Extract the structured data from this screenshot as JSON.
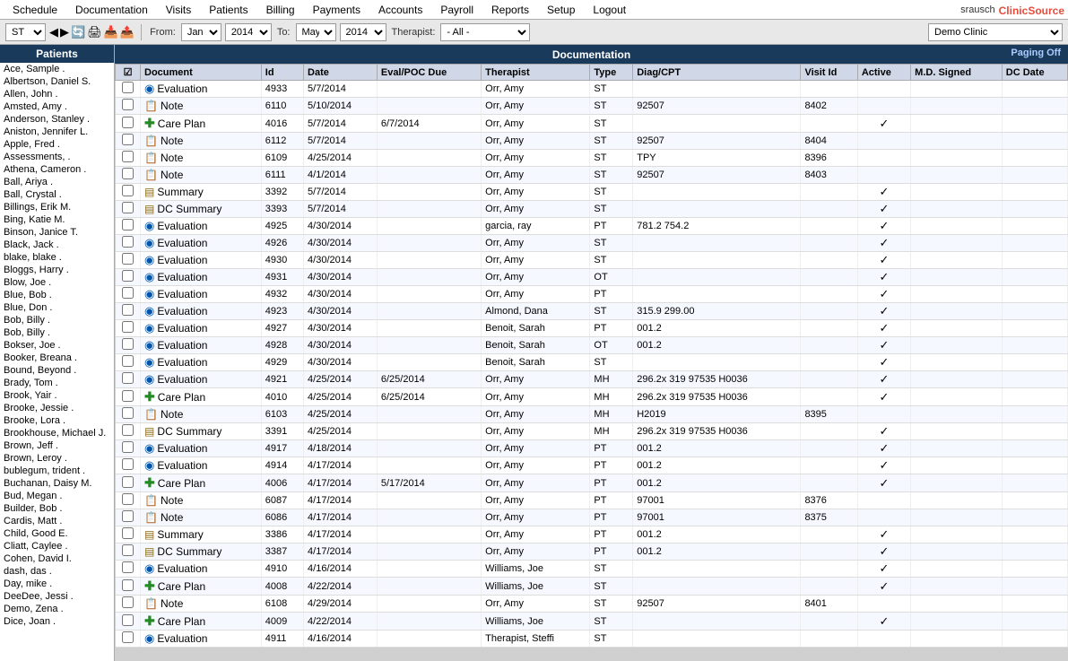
{
  "nav": {
    "items": [
      "Schedule",
      "Documentation",
      "Visits",
      "Patients",
      "Billing",
      "Payments",
      "Accounts",
      "Payroll",
      "Reports",
      "Setup",
      "Logout"
    ],
    "user": "srausch",
    "brand_prefix": "Clinic",
    "brand_suffix": "Source"
  },
  "toolbar": {
    "type_label": "ST",
    "from_label": "From:",
    "from_month": "Jan",
    "from_year": "2014",
    "to_label": "To:",
    "to_month": "May",
    "to_year": "2014",
    "therapist_label": "Therapist:",
    "therapist_value": "- All -",
    "clinic_name": "Demo Clinic"
  },
  "patients": {
    "header": "Patients",
    "list": [
      "Ace, Sample .",
      "Albertson, Daniel S.",
      "Allen, John .",
      "Amsted, Amy .",
      "Anderson, Stanley .",
      "Aniston, Jennifer L.",
      "Apple, Fred .",
      "Assessments, .",
      "Athena, Cameron .",
      "Ball, Ariya .",
      "Ball, Crystal .",
      "Billings, Erik M.",
      "Bing, Katie M.",
      "Binson, Janice T.",
      "Black, Jack .",
      "blake, blake .",
      "Bloggs, Harry .",
      "Blow, Joe .",
      "Blue, Bob .",
      "Blue, Don .",
      "Bob, Billy .",
      "Bob, Billy .",
      "Bokser, Joe .",
      "Booker, Breana .",
      "Bound, Beyond .",
      "Brady, Tom .",
      "Brook, Yair .",
      "Brooke, Jessie .",
      "Brooke, Lora .",
      "Brookhouse, Michael J.",
      "Brown, Jeff .",
      "Brown, Leroy .",
      "bublegum, trident .",
      "Buchanan, Daisy M.",
      "Bud, Megan .",
      "Builder, Bob .",
      "Cardis, Matt .",
      "Child, Good E.",
      "Cliatt, Caylee .",
      "Cohen, David I.",
      "dash, das .",
      "Day, mike .",
      "DeeDee, Jessi .",
      "Demo, Zena .",
      "Dice, Joan ."
    ]
  },
  "documentation": {
    "header": "Documentation",
    "paging_off": "Paging Off",
    "columns": [
      "",
      "Document",
      "Id",
      "Date",
      "Eval/POC Due",
      "Therapist",
      "Type",
      "Diag/CPT",
      "Visit Id",
      "Active",
      "M.D. Signed",
      "DC Date"
    ],
    "rows": [
      {
        "checked": false,
        "icon": "eval",
        "doc": "Evaluation",
        "id": "4933",
        "date": "5/7/2014",
        "eval_due": "",
        "therapist": "Orr, Amy",
        "type": "ST",
        "diag": "",
        "visit_id": "",
        "active": false,
        "md_signed": false,
        "dc_date": ""
      },
      {
        "checked": false,
        "icon": "note",
        "doc": "Note",
        "id": "6110",
        "date": "5/10/2014",
        "eval_due": "",
        "therapist": "Orr, Amy",
        "type": "ST",
        "diag": "92507",
        "visit_id": "8402",
        "active": false,
        "md_signed": false,
        "dc_date": ""
      },
      {
        "checked": false,
        "icon": "careplan",
        "doc": "Care Plan",
        "id": "4016",
        "date": "5/7/2014",
        "eval_due": "6/7/2014",
        "therapist": "Orr, Amy",
        "type": "ST",
        "diag": "",
        "visit_id": "",
        "active": true,
        "md_signed": false,
        "dc_date": ""
      },
      {
        "checked": false,
        "icon": "note",
        "doc": "Note",
        "id": "6112",
        "date": "5/7/2014",
        "eval_due": "",
        "therapist": "Orr, Amy",
        "type": "ST",
        "diag": "92507",
        "visit_id": "8404",
        "active": false,
        "md_signed": false,
        "dc_date": ""
      },
      {
        "checked": false,
        "icon": "note",
        "doc": "Note",
        "id": "6109",
        "date": "4/25/2014",
        "eval_due": "",
        "therapist": "Orr, Amy",
        "type": "ST",
        "diag": "TPY",
        "visit_id": "8396",
        "active": false,
        "md_signed": false,
        "dc_date": ""
      },
      {
        "checked": false,
        "icon": "note",
        "doc": "Note",
        "id": "6111",
        "date": "4/1/2014",
        "eval_due": "",
        "therapist": "Orr, Amy",
        "type": "ST",
        "diag": "92507",
        "visit_id": "8403",
        "active": false,
        "md_signed": false,
        "dc_date": ""
      },
      {
        "checked": false,
        "icon": "summary",
        "doc": "Summary",
        "id": "3392",
        "date": "5/7/2014",
        "eval_due": "",
        "therapist": "Orr, Amy",
        "type": "ST",
        "diag": "",
        "visit_id": "",
        "active": true,
        "md_signed": false,
        "dc_date": ""
      },
      {
        "checked": false,
        "icon": "dc",
        "doc": "DC Summary",
        "id": "3393",
        "date": "5/7/2014",
        "eval_due": "",
        "therapist": "Orr, Amy",
        "type": "ST",
        "diag": "",
        "visit_id": "",
        "active": true,
        "md_signed": false,
        "dc_date": ""
      },
      {
        "checked": false,
        "icon": "eval",
        "doc": "Evaluation",
        "id": "4925",
        "date": "4/30/2014",
        "eval_due": "",
        "therapist": "garcia, ray",
        "type": "PT",
        "diag": "781.2 754.2",
        "visit_id": "",
        "active": true,
        "md_signed": false,
        "dc_date": ""
      },
      {
        "checked": false,
        "icon": "eval",
        "doc": "Evaluation",
        "id": "4926",
        "date": "4/30/2014",
        "eval_due": "",
        "therapist": "Orr, Amy",
        "type": "ST",
        "diag": "",
        "visit_id": "",
        "active": true,
        "md_signed": false,
        "dc_date": ""
      },
      {
        "checked": false,
        "icon": "eval",
        "doc": "Evaluation",
        "id": "4930",
        "date": "4/30/2014",
        "eval_due": "",
        "therapist": "Orr, Amy",
        "type": "ST",
        "diag": "",
        "visit_id": "",
        "active": true,
        "md_signed": false,
        "dc_date": ""
      },
      {
        "checked": false,
        "icon": "eval",
        "doc": "Evaluation",
        "id": "4931",
        "date": "4/30/2014",
        "eval_due": "",
        "therapist": "Orr, Amy",
        "type": "OT",
        "diag": "",
        "visit_id": "",
        "active": true,
        "md_signed": false,
        "dc_date": ""
      },
      {
        "checked": false,
        "icon": "eval",
        "doc": "Evaluation",
        "id": "4932",
        "date": "4/30/2014",
        "eval_due": "",
        "therapist": "Orr, Amy",
        "type": "PT",
        "diag": "",
        "visit_id": "",
        "active": true,
        "md_signed": false,
        "dc_date": ""
      },
      {
        "checked": false,
        "icon": "eval",
        "doc": "Evaluation",
        "id": "4923",
        "date": "4/30/2014",
        "eval_due": "",
        "therapist": "Almond, Dana",
        "type": "ST",
        "diag": "315.9 299.00",
        "visit_id": "",
        "active": true,
        "md_signed": false,
        "dc_date": ""
      },
      {
        "checked": false,
        "icon": "eval",
        "doc": "Evaluation",
        "id": "4927",
        "date": "4/30/2014",
        "eval_due": "",
        "therapist": "Benoit, Sarah",
        "type": "PT",
        "diag": "001.2",
        "visit_id": "",
        "active": true,
        "md_signed": false,
        "dc_date": ""
      },
      {
        "checked": false,
        "icon": "eval",
        "doc": "Evaluation",
        "id": "4928",
        "date": "4/30/2014",
        "eval_due": "",
        "therapist": "Benoit, Sarah",
        "type": "OT",
        "diag": "001.2",
        "visit_id": "",
        "active": true,
        "md_signed": false,
        "dc_date": ""
      },
      {
        "checked": false,
        "icon": "eval",
        "doc": "Evaluation",
        "id": "4929",
        "date": "4/30/2014",
        "eval_due": "",
        "therapist": "Benoit, Sarah",
        "type": "ST",
        "diag": "",
        "visit_id": "",
        "active": true,
        "md_signed": false,
        "dc_date": ""
      },
      {
        "checked": false,
        "icon": "eval",
        "doc": "Evaluation",
        "id": "4921",
        "date": "4/25/2014",
        "eval_due": "6/25/2014",
        "therapist": "Orr, Amy",
        "type": "MH",
        "diag": "296.2x 319 97535 H0036",
        "visit_id": "",
        "active": true,
        "md_signed": false,
        "dc_date": ""
      },
      {
        "checked": false,
        "icon": "careplan",
        "doc": "Care Plan",
        "id": "4010",
        "date": "4/25/2014",
        "eval_due": "6/25/2014",
        "therapist": "Orr, Amy",
        "type": "MH",
        "diag": "296.2x 319 97535 H0036",
        "visit_id": "",
        "active": true,
        "md_signed": false,
        "dc_date": ""
      },
      {
        "checked": false,
        "icon": "note",
        "doc": "Note",
        "id": "6103",
        "date": "4/25/2014",
        "eval_due": "",
        "therapist": "Orr, Amy",
        "type": "MH",
        "diag": "H2019",
        "visit_id": "8395",
        "active": false,
        "md_signed": false,
        "dc_date": ""
      },
      {
        "checked": false,
        "icon": "dc",
        "doc": "DC Summary",
        "id": "3391",
        "date": "4/25/2014",
        "eval_due": "",
        "therapist": "Orr, Amy",
        "type": "MH",
        "diag": "296.2x 319 97535 H0036",
        "visit_id": "",
        "active": true,
        "md_signed": false,
        "dc_date": ""
      },
      {
        "checked": false,
        "icon": "eval",
        "doc": "Evaluation",
        "id": "4917",
        "date": "4/18/2014",
        "eval_due": "",
        "therapist": "Orr, Amy",
        "type": "PT",
        "diag": "001.2",
        "visit_id": "",
        "active": true,
        "md_signed": false,
        "dc_date": ""
      },
      {
        "checked": false,
        "icon": "eval",
        "doc": "Evaluation",
        "id": "4914",
        "date": "4/17/2014",
        "eval_due": "",
        "therapist": "Orr, Amy",
        "type": "PT",
        "diag": "001.2",
        "visit_id": "",
        "active": true,
        "md_signed": false,
        "dc_date": ""
      },
      {
        "checked": false,
        "icon": "careplan",
        "doc": "Care Plan",
        "id": "4006",
        "date": "4/17/2014",
        "eval_due": "5/17/2014",
        "therapist": "Orr, Amy",
        "type": "PT",
        "diag": "001.2",
        "visit_id": "",
        "active": true,
        "md_signed": false,
        "dc_date": ""
      },
      {
        "checked": false,
        "icon": "note",
        "doc": "Note",
        "id": "6087",
        "date": "4/17/2014",
        "eval_due": "",
        "therapist": "Orr, Amy",
        "type": "PT",
        "diag": "97001",
        "visit_id": "8376",
        "active": false,
        "md_signed": false,
        "dc_date": ""
      },
      {
        "checked": false,
        "icon": "note",
        "doc": "Note",
        "id": "6086",
        "date": "4/17/2014",
        "eval_due": "",
        "therapist": "Orr, Amy",
        "type": "PT",
        "diag": "97001",
        "visit_id": "8375",
        "active": false,
        "md_signed": false,
        "dc_date": ""
      },
      {
        "checked": false,
        "icon": "summary",
        "doc": "Summary",
        "id": "3386",
        "date": "4/17/2014",
        "eval_due": "",
        "therapist": "Orr, Amy",
        "type": "PT",
        "diag": "001.2",
        "visit_id": "",
        "active": true,
        "md_signed": false,
        "dc_date": ""
      },
      {
        "checked": false,
        "icon": "dc",
        "doc": "DC Summary",
        "id": "3387",
        "date": "4/17/2014",
        "eval_due": "",
        "therapist": "Orr, Amy",
        "type": "PT",
        "diag": "001.2",
        "visit_id": "",
        "active": true,
        "md_signed": false,
        "dc_date": ""
      },
      {
        "checked": false,
        "icon": "eval",
        "doc": "Evaluation",
        "id": "4910",
        "date": "4/16/2014",
        "eval_due": "",
        "therapist": "Williams, Joe",
        "type": "ST",
        "diag": "",
        "visit_id": "",
        "active": true,
        "md_signed": false,
        "dc_date": ""
      },
      {
        "checked": false,
        "icon": "careplan",
        "doc": "Care Plan",
        "id": "4008",
        "date": "4/22/2014",
        "eval_due": "",
        "therapist": "Williams, Joe",
        "type": "ST",
        "diag": "",
        "visit_id": "",
        "active": true,
        "md_signed": false,
        "dc_date": ""
      },
      {
        "checked": false,
        "icon": "note",
        "doc": "Note",
        "id": "6108",
        "date": "4/29/2014",
        "eval_due": "",
        "therapist": "Orr, Amy",
        "type": "ST",
        "diag": "92507",
        "visit_id": "8401",
        "active": false,
        "md_signed": false,
        "dc_date": ""
      },
      {
        "checked": false,
        "icon": "careplan",
        "doc": "Care Plan",
        "id": "4009",
        "date": "4/22/2014",
        "eval_due": "",
        "therapist": "Williams, Joe",
        "type": "ST",
        "diag": "",
        "visit_id": "",
        "active": true,
        "md_signed": false,
        "dc_date": ""
      },
      {
        "checked": false,
        "icon": "eval",
        "doc": "Evaluation",
        "id": "4911",
        "date": "4/16/2014",
        "eval_due": "",
        "therapist": "Therapist, Steffi",
        "type": "ST",
        "diag": "",
        "visit_id": "",
        "active": false,
        "md_signed": false,
        "dc_date": ""
      }
    ]
  },
  "icons": {
    "eval": "🔵",
    "note": "📄",
    "careplan": "➕",
    "summary": "🟫",
    "dc": "🟫",
    "checkmark": "✓",
    "checkbox_checked": "☑",
    "checkbox_unchecked": "☐",
    "toolbar_icons": [
      "⬅",
      "➡",
      "🔄",
      "🖨",
      "📥",
      "📤"
    ]
  }
}
